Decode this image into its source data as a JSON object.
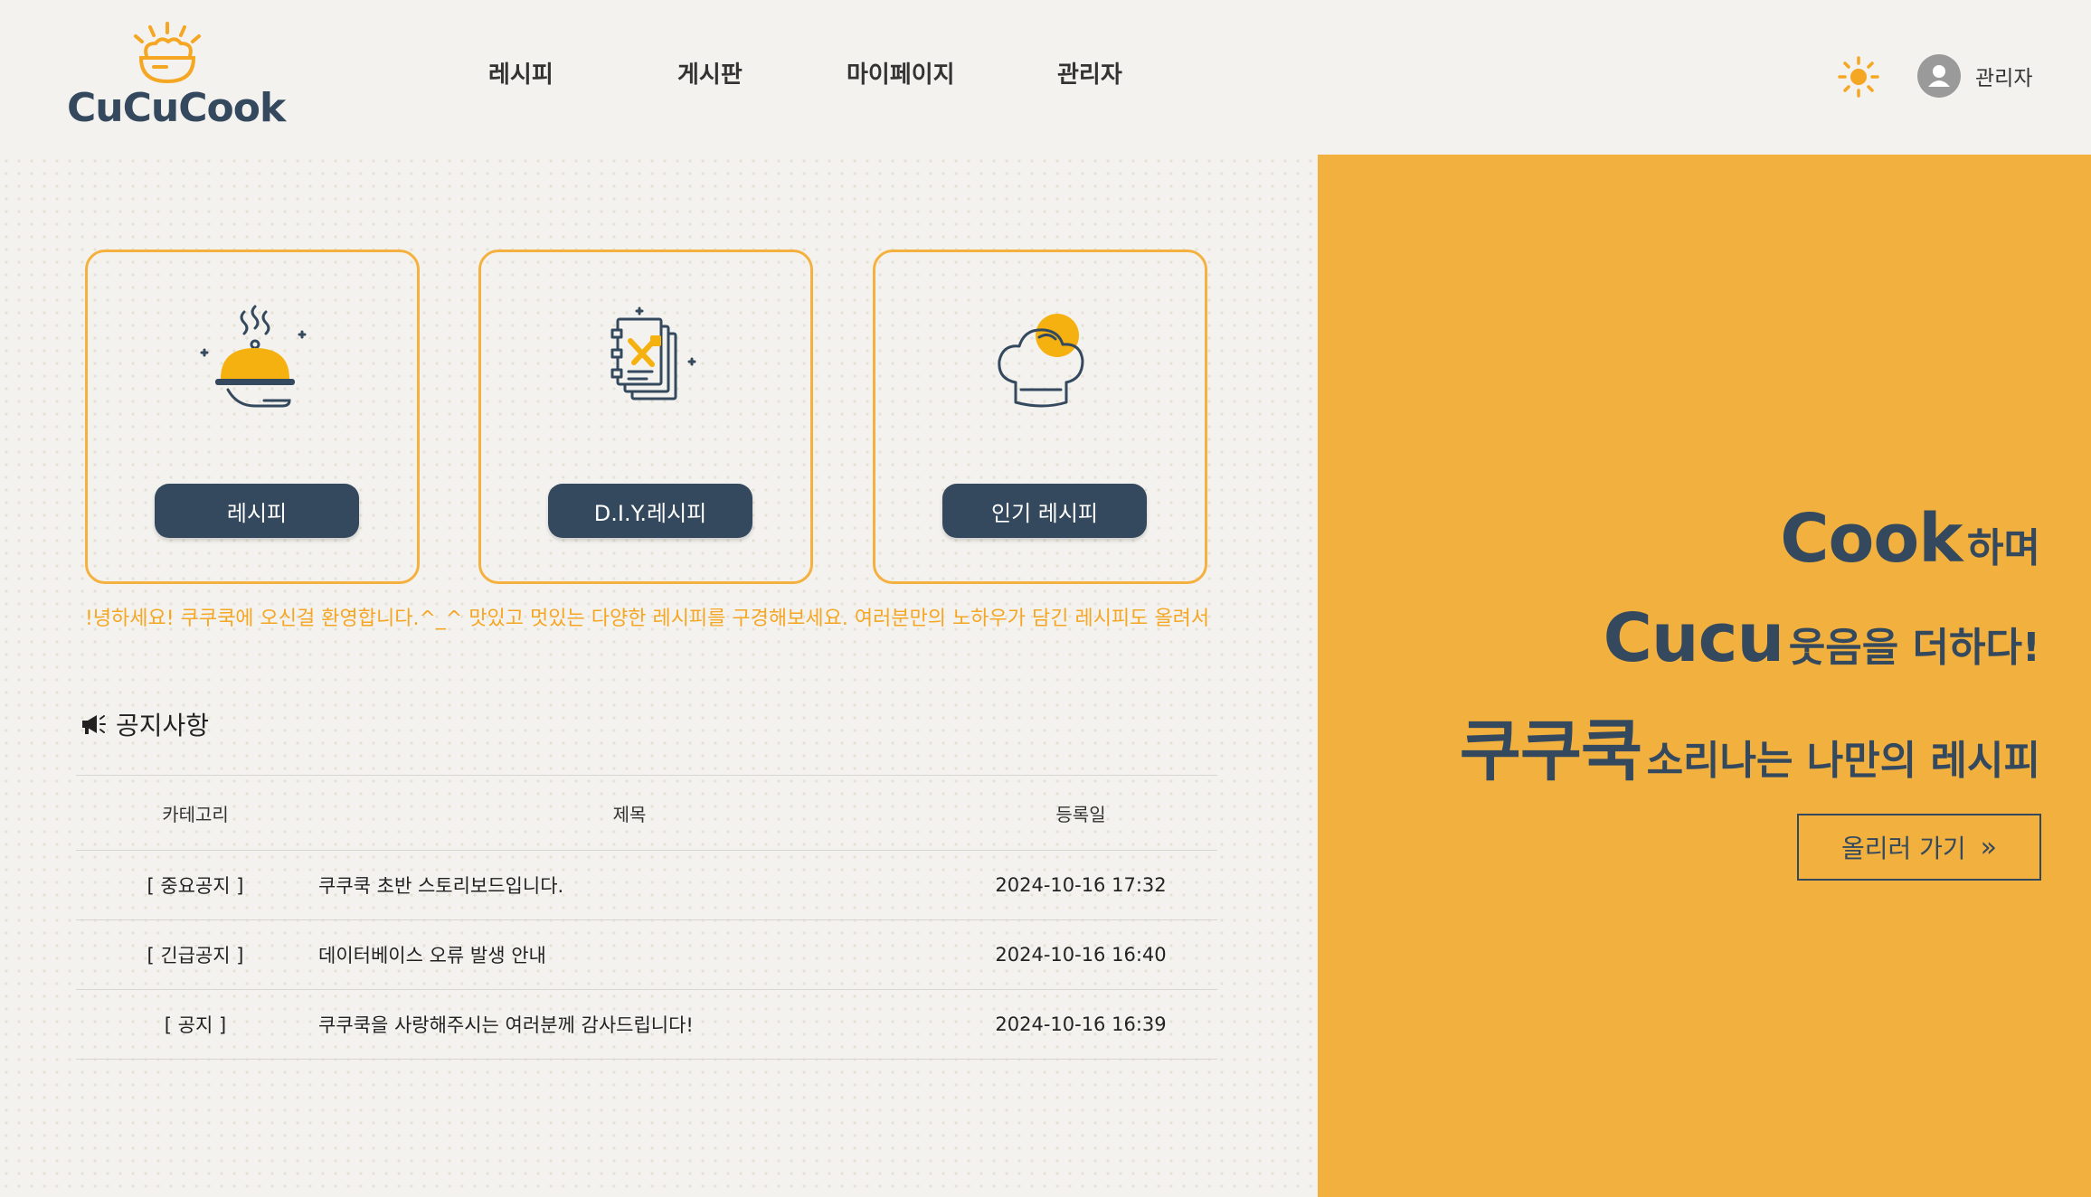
{
  "header": {
    "logo_text": "CuCuCook",
    "nav": [
      "레시피",
      "게시판",
      "마이페이지",
      "관리자"
    ],
    "user_name": "관리자"
  },
  "cards": [
    {
      "button": "레시피",
      "icon": "serving-cloche-icon"
    },
    {
      "button": "D.I.Y.레시피",
      "icon": "recipe-notebook-icon"
    },
    {
      "button": "인기 레시피",
      "icon": "chef-hat-icon"
    }
  ],
  "marquee": "!녕하세요! 쿠쿠쿡에 오신걸 환영합니다.^_^ 맛있고 멋있는 다양한 레시피를 구경해보세요. 여러분만의 노하우가 담긴 레시피도 올려서",
  "notice": {
    "title": "공지사항",
    "columns": [
      "카테고리",
      "제목",
      "등록일"
    ],
    "rows": [
      {
        "category": "[ 중요공지 ]",
        "title": "쿠쿠쿡 초반 스토리보드입니다.",
        "date": "2024-10-16 17:32"
      },
      {
        "category": "[ 긴급공지 ]",
        "title": "데이터베이스 오류 발생 안내",
        "date": "2024-10-16 16:40"
      },
      {
        "category": "[ 공지 ]",
        "title": "쿠쿠쿡을 사랑해주시는 여러분께 감사드립니다!",
        "date": "2024-10-16 16:39"
      }
    ]
  },
  "hero": {
    "line1_big": "Cook",
    "line1_small": "하며",
    "line2_big": "Cucu",
    "line2_small": "웃음을 더하다!",
    "line3_big": "쿠쿠쿡",
    "line3_small": "소리나는 나만의 레시피",
    "cta": "올리러 가기",
    "cta_arrow": "»"
  },
  "colors": {
    "accent": "#f2b03f",
    "navy": "#34495e",
    "urgent": "#e0472d",
    "info": "#2e9be0"
  }
}
